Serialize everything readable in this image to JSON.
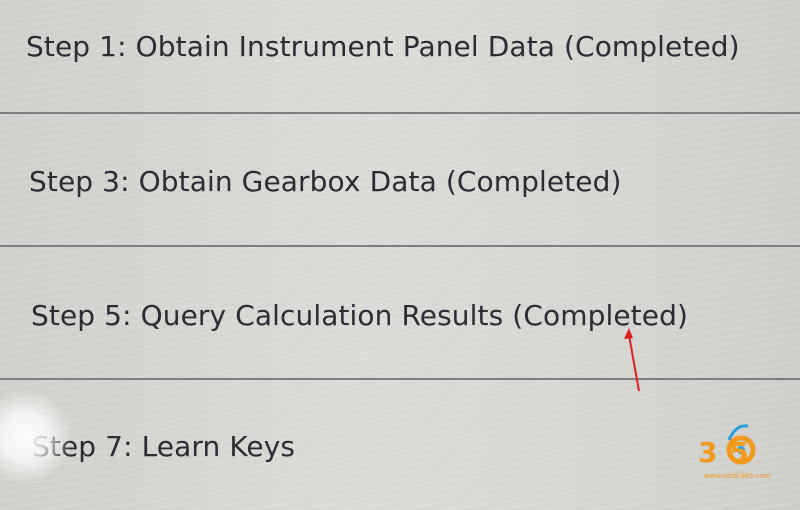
{
  "steps": [
    {
      "label": "Step 1: Obtain Instrument Panel Data (Completed)"
    },
    {
      "label": "Step 3: Obtain Gearbox Data (Completed)"
    },
    {
      "label": "Step 5: Query Calculation Results (Completed)"
    },
    {
      "label": "Step 7: Learn Keys"
    }
  ],
  "watermark": {
    "logo_text": "3 5",
    "url": "www.obdii365.com"
  },
  "colors": {
    "text": "#2b2d33",
    "divider": "#7d7e80",
    "annotation_arrow": "#e02020",
    "watermark": "#f29a1e"
  }
}
